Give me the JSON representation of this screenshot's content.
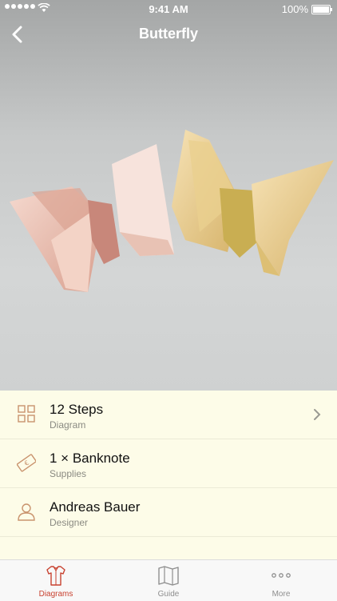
{
  "status_bar": {
    "time": "9:41 AM",
    "battery": "100%"
  },
  "nav": {
    "title": "Butterfly"
  },
  "info_rows": [
    {
      "title": "12 Steps",
      "subtitle": "Diagram",
      "icon": "grid-icon",
      "has_chevron": true
    },
    {
      "title": "1 × Banknote",
      "subtitle": "Supplies",
      "icon": "banknote-icon",
      "has_chevron": false
    },
    {
      "title": "Andreas Bauer",
      "subtitle": "Designer",
      "icon": "person-icon",
      "has_chevron": false
    }
  ],
  "tabs": [
    {
      "label": "Diagrams",
      "icon": "shirt-icon",
      "active": true
    },
    {
      "label": "Guide",
      "icon": "map-icon",
      "active": false
    },
    {
      "label": "More",
      "icon": "more-dots-icon",
      "active": false
    }
  ],
  "colors": {
    "accent": "#c8412f",
    "icon_tint": "#c9936d",
    "panel_bg": "#fdfce8"
  }
}
